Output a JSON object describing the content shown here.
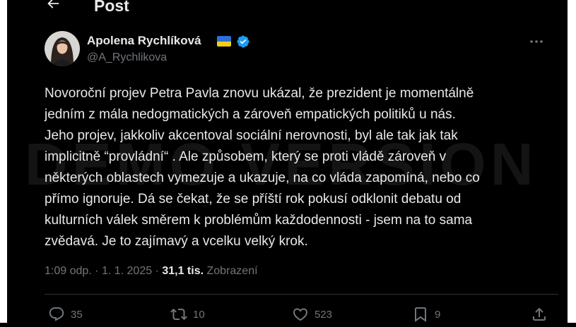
{
  "header": {
    "title": "Post"
  },
  "author": {
    "name": "Apolena Rychlíková",
    "handle": "@A_Rychlikova"
  },
  "tweet": {
    "text": "Novoroční projev Petra Pavla znovu ukázal, že prezident je momentálně\njedním z mála nedogmatických a zároveň empatických politiků u nás.\nJeho projev, jakkoliv akcentoval sociální nerovnosti, byl ale tak jak tak\nimplicitně “provládní“ . Ale způsobem, který se proti vládě zároveň v\nněkterých oblastech vymezuje a ukazuje, na co vláda zapomíná, nebo co\npřímo ignoruje. Dá se čekat, že se příští rok pokusí odklonit debatu od\nkulturních válek směrem k problémům každodennosti - jsem na to sama\nzvědavá. Je to zajímavý a vcelku velký krok."
  },
  "meta": {
    "time": "1:09 odp.",
    "sep1": " · ",
    "date": "1. 1. 2025",
    "sep2": " · ",
    "views": "31,1 tis.",
    "views_label": " Zobrazení"
  },
  "actions": {
    "replies": "35",
    "reposts": "10",
    "likes": "523",
    "bookmarks": "9"
  },
  "watermark": "DEMO VERSION",
  "colors": {
    "background": "#000000",
    "text": "#e7e9ea",
    "muted": "#71767b",
    "verified": "#1d9bf0",
    "flag_blue": "#2f6fd6",
    "flag_yellow": "#f2cc1b"
  },
  "icons": {
    "back": "arrow-left-icon",
    "verified": "verified-badge-icon",
    "flag": "ukraine-flag-icon",
    "more": "more-dots-icon",
    "reply": "reply-icon",
    "repost": "repost-icon",
    "like": "heart-icon",
    "bookmark": "bookmark-icon",
    "share": "share-icon"
  }
}
